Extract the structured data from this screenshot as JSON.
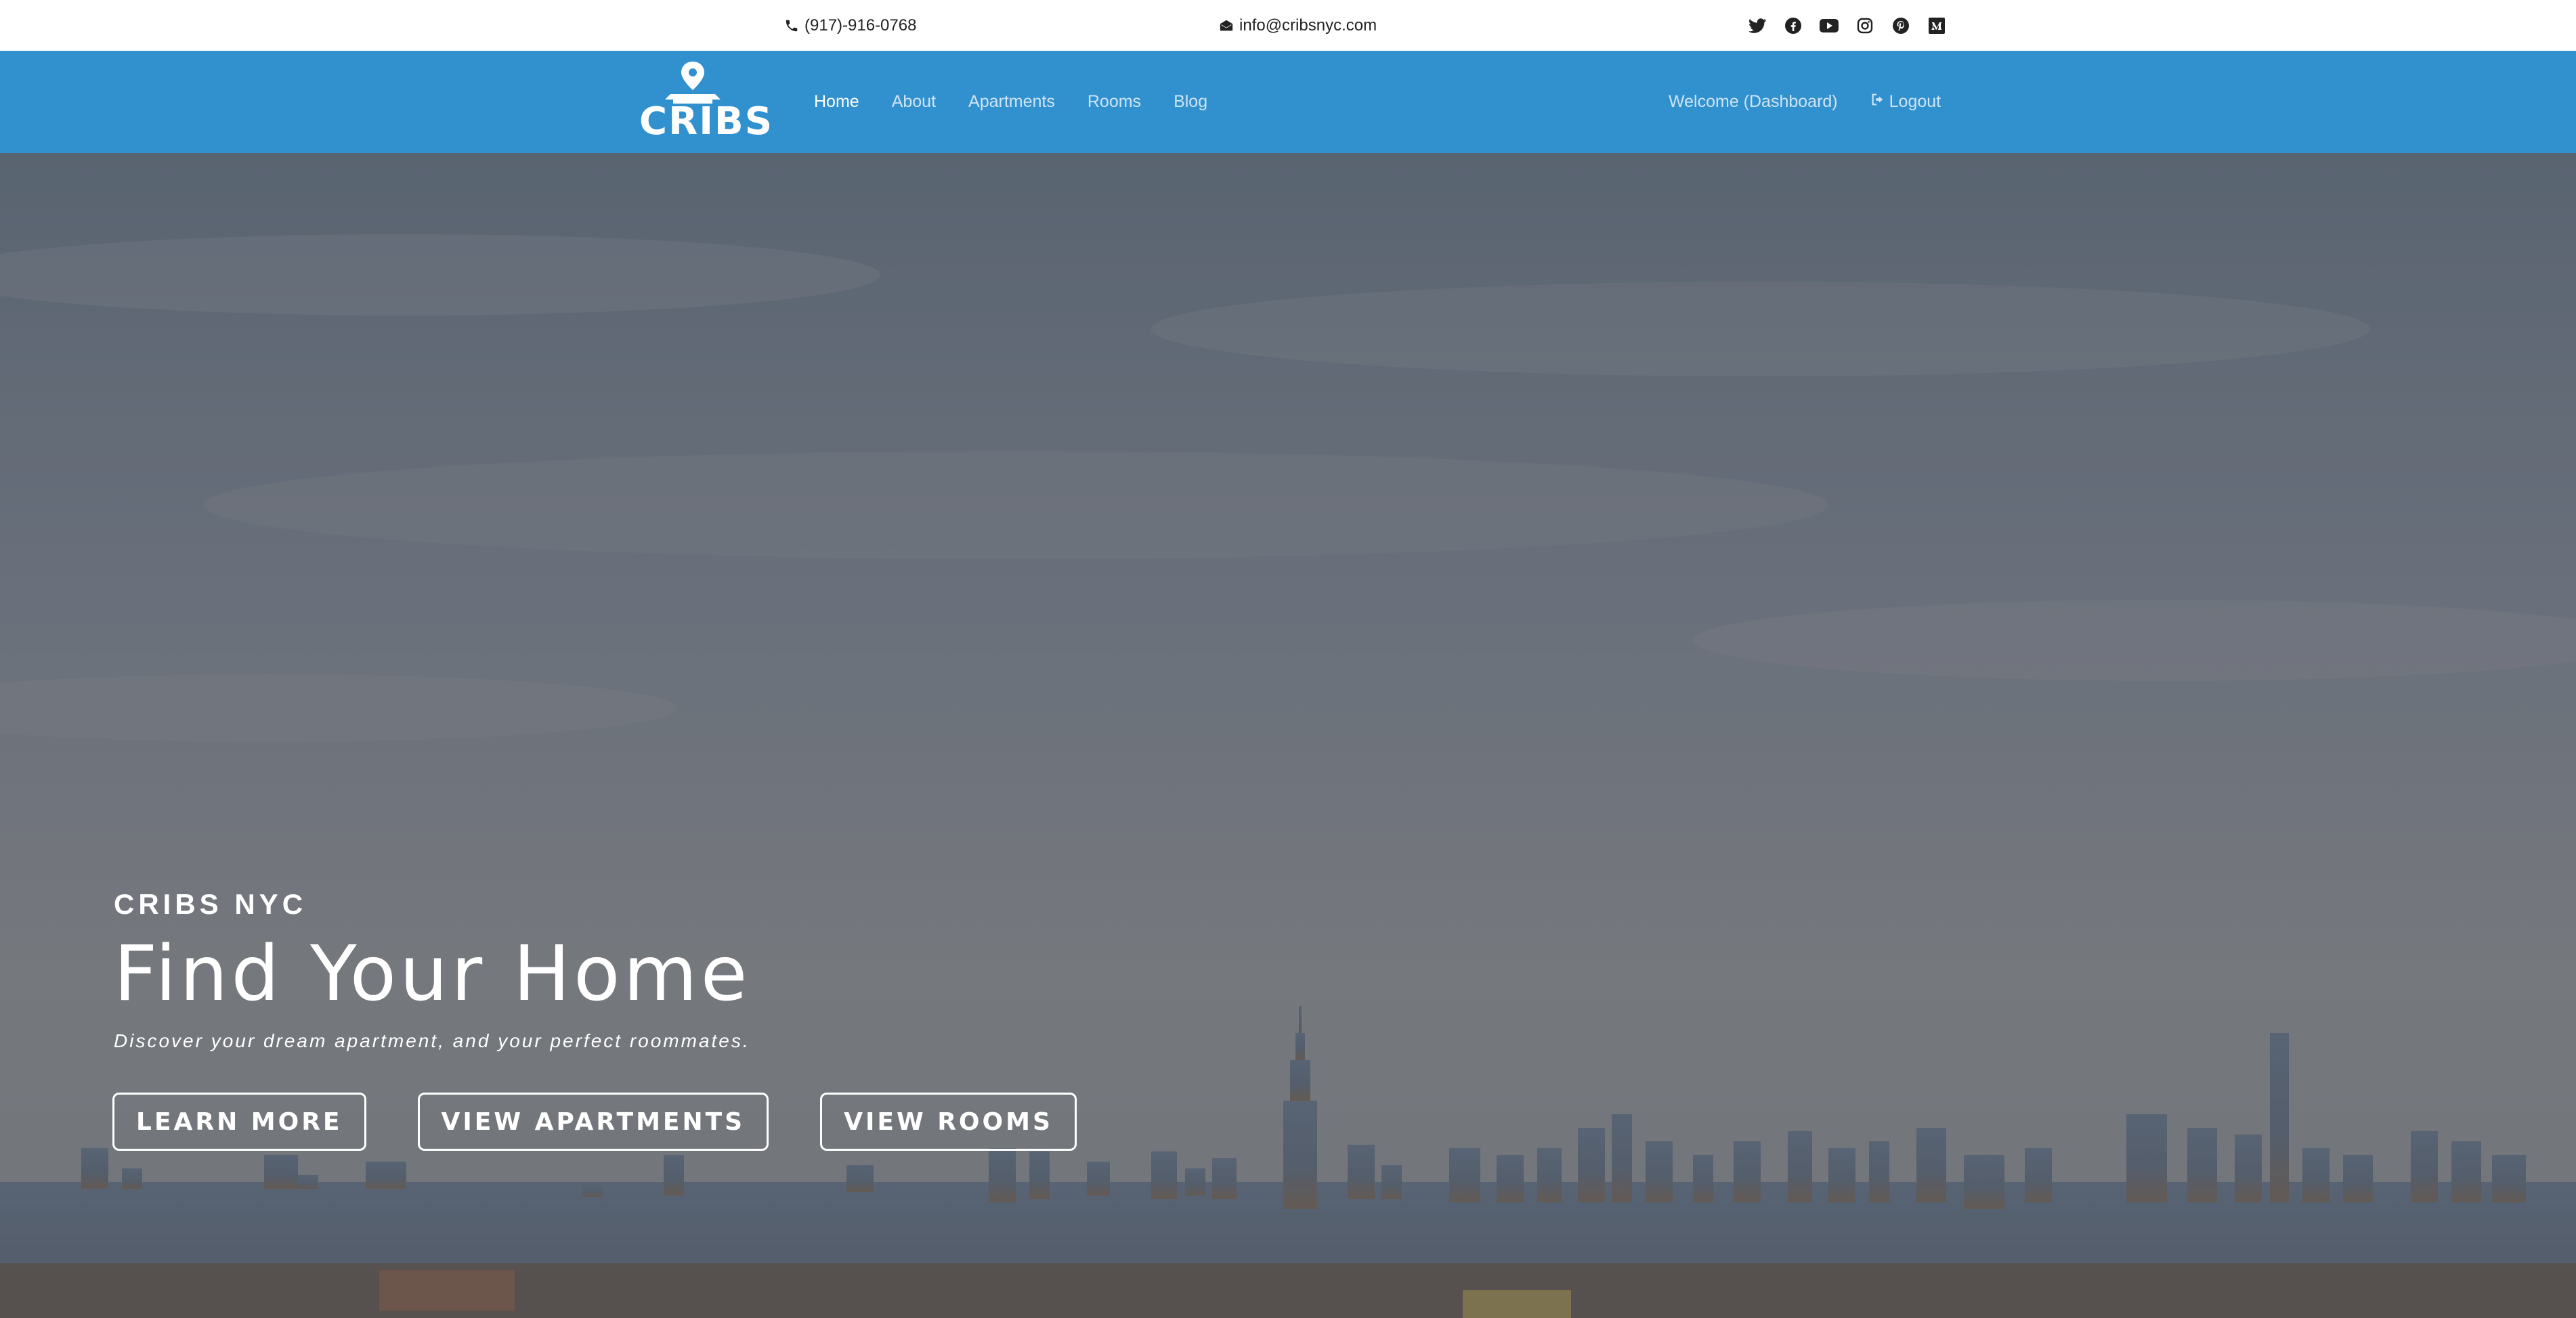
{
  "topbar": {
    "phone": "(917)-916-0768",
    "email": "info@cribsnyc.com",
    "socials": [
      "twitter-icon",
      "facebook-icon",
      "youtube-icon",
      "instagram-icon",
      "pinterest-icon",
      "medium-icon"
    ]
  },
  "navbar": {
    "logo_text": "CRIBS",
    "links": [
      "Home",
      "About",
      "Apartments",
      "Rooms",
      "Blog"
    ],
    "active": "Home",
    "welcome": "Welcome (Dashboard)",
    "logout": "Logout"
  },
  "hero": {
    "eyebrow": "CRIBS NYC",
    "headline": "Find Your Home",
    "subtitle": "Discover your dream apartment, and your perfect roommates.",
    "buttons": [
      "LEARN MORE",
      "VIEW APARTMENTS",
      "VIEW ROOMS"
    ]
  },
  "colors": {
    "navbar_bg": "#3191cf",
    "topbar_bg": "#ffffff",
    "hero_text": "#ffffff"
  }
}
